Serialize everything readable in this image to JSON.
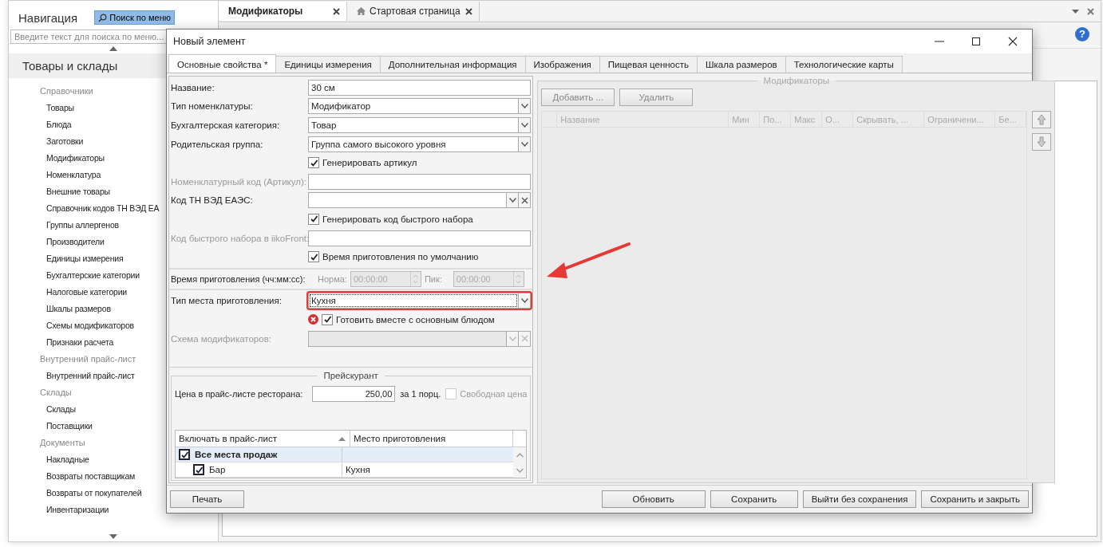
{
  "sidebar": {
    "title": "Навигация",
    "search_button": "Поиск по меню",
    "search": {
      "placeholder": "Введите текст для поиска по меню..."
    },
    "section": "Товары и склады",
    "groups": [
      {
        "label": "Справочники",
        "items": [
          "Товары",
          "Блюда",
          "Заготовки",
          "Модификаторы",
          "Номенклатура",
          "Внешние товары",
          "Справочник кодов ТН ВЭД ЕА",
          "Группы аллергенов",
          "Производители",
          "Единицы измерения",
          "Бухгалтерские категории",
          "Налоговые категории",
          "Шкалы размеров",
          "Схемы модификаторов",
          "Признаки расчета"
        ]
      },
      {
        "label": "Внутренний прайс-лист",
        "items": [
          "Внутренний прайс-лист"
        ]
      },
      {
        "label": "Склады",
        "items": [
          "Склады",
          "Поставщики"
        ]
      },
      {
        "label": "Документы",
        "items": [
          "Накладные",
          "Возвраты поставщикам",
          "Возвраты от покупателей",
          "Инвентаризации"
        ]
      }
    ]
  },
  "doc_tabs": [
    {
      "label": "Модификаторы",
      "selected": true,
      "home": false
    },
    {
      "label": "Стартовая страница",
      "selected": false,
      "home": true
    }
  ],
  "help": "?",
  "dialog": {
    "title": "Новый элемент",
    "tabs": [
      {
        "label": "Основные свойства *",
        "selected": true
      },
      {
        "label": "Единицы измерения",
        "selected": false
      },
      {
        "label": "Дополнительная информация",
        "selected": false
      },
      {
        "label": "Изображения",
        "selected": false
      },
      {
        "label": "Пищевая ценность",
        "selected": false
      },
      {
        "label": "Шкала размеров",
        "selected": false
      },
      {
        "label": "Технологические карты",
        "selected": false
      }
    ],
    "fields": [
      {
        "kind": "input",
        "label": "Название:",
        "value": "30 см",
        "label_dimmed": false
      },
      {
        "kind": "select",
        "label": "Тип номенклатуры:",
        "value": "Модификатор",
        "highlighted": false
      },
      {
        "kind": "select",
        "label": "Бухгалтерская категория:",
        "value": "Товар",
        "highlighted": false
      },
      {
        "kind": "select",
        "label": "Родительская группа:",
        "value": "Группа самого высокого уровня",
        "highlighted": false
      },
      {
        "kind": "checkbox",
        "text": "Генерировать артикул",
        "checked": true,
        "error": false
      },
      {
        "kind": "input",
        "label": "Номенклатурный код (Артикул):",
        "label_dimmed": true
      },
      {
        "kind": "combo",
        "label": "Код ТН ВЭД ЕАЭС:",
        "label_dimmed": false,
        "disabled": false
      },
      {
        "kind": "checkbox",
        "text": "Генерировать код быстрого набора",
        "checked": true,
        "error": false
      },
      {
        "kind": "input",
        "label": "Код быстрого набора в iikoFront:",
        "label_dimmed": true
      },
      {
        "kind": "checkbox",
        "text": "Время приготовления по умолчанию",
        "checked": true,
        "error": false
      },
      {
        "kind": "time",
        "label": "Время приготовления (чч:мм:сс):",
        "norm_label": "Норма:",
        "norm": "00:00:00",
        "peak_label": "Пик:",
        "peak": "00:00:00"
      },
      {
        "kind": "select",
        "label": "Тип места приготовления:",
        "value": "Кухня",
        "highlighted": true
      },
      {
        "kind": "checkbox",
        "text": "Готовить вместе с основным блюдом",
        "checked": true,
        "error": true
      },
      {
        "kind": "combo",
        "label": "Схема модификаторов:",
        "label_dimmed": true,
        "disabled": true
      }
    ],
    "price": {
      "legend": "Прейскурант",
      "label": "Цена в прайс-листе ресторана:",
      "value": "250,00",
      "unit": "за 1 порц.",
      "free_price": {
        "text": "Свободная цена",
        "checked": false
      },
      "columns": [
        "Включать в прайс-лист",
        "Место приготовления"
      ],
      "rows": [
        {
          "name": "Все места продаж",
          "place_col": "",
          "checked": true,
          "group": true
        },
        {
          "name": "Бар",
          "place": "Кухня",
          "checked": true,
          "group": false
        }
      ]
    },
    "modifiers": {
      "legend": "Модификаторы",
      "buttons": [
        "Добавить ...",
        "Удалить"
      ],
      "columns": [
        "Название",
        "Мин",
        "По...",
        "Макс",
        "О...",
        "Скрывать, ...",
        "Ограничени...",
        "Бе..."
      ]
    },
    "footer": {
      "left": "Печать",
      "right": [
        "Обновить",
        "Сохранить",
        "Выйти без сохранения",
        "Сохранить и закрыть"
      ]
    }
  }
}
